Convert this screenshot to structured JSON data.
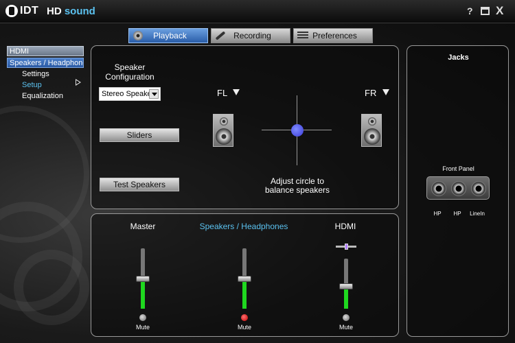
{
  "window": {
    "brand": "IDT",
    "app_name_main": "HD",
    "app_name_accent": "sound",
    "help_label": "?",
    "close_label": "X"
  },
  "tabs": [
    {
      "label": "Playback",
      "icon": "cd-icon",
      "active": true
    },
    {
      "label": "Recording",
      "icon": "microphone-icon",
      "active": false
    },
    {
      "label": "Preferences",
      "icon": "list-icon",
      "active": false
    }
  ],
  "sidebar": {
    "items": [
      {
        "label": "HDMI"
      },
      {
        "label": "Speakers / Headphones"
      },
      {
        "label": "Settings"
      },
      {
        "label": "Setup",
        "selected": true
      },
      {
        "label": "Equalization"
      }
    ]
  },
  "config": {
    "speaker_config_line1": "Speaker",
    "speaker_config_line2": "Configuration",
    "speaker_select_value": "Stereo Speakers",
    "sliders_button": "Sliders",
    "test_button": "Test Speakers",
    "fl_label": "FL",
    "fr_label": "FR",
    "balance_hint_line1": "Adjust circle to",
    "balance_hint_line2": "balance speakers"
  },
  "volume": {
    "master": {
      "label": "Master",
      "mute_label": "Mute",
      "level": 0.5,
      "muted": false
    },
    "speakers": {
      "label": "Speakers / Headphones",
      "mute_label": "Mute",
      "level": 0.5,
      "muted": true
    },
    "hdmi": {
      "label": "HDMI",
      "mute_label": "Mute",
      "level": 0.45,
      "muted": false
    }
  },
  "jacks": {
    "title": "Jacks",
    "front_panel_label": "Front Panel",
    "items": [
      {
        "label": "HP"
      },
      {
        "label": "HP"
      },
      {
        "label": "LineIn"
      }
    ]
  },
  "colors": {
    "accent": "#5bc2f0",
    "active_tab": "#2a5da8",
    "volume_fill": "#1fd81f",
    "mute_on": "#c00000",
    "balance_dot": "#3a3ad8"
  }
}
